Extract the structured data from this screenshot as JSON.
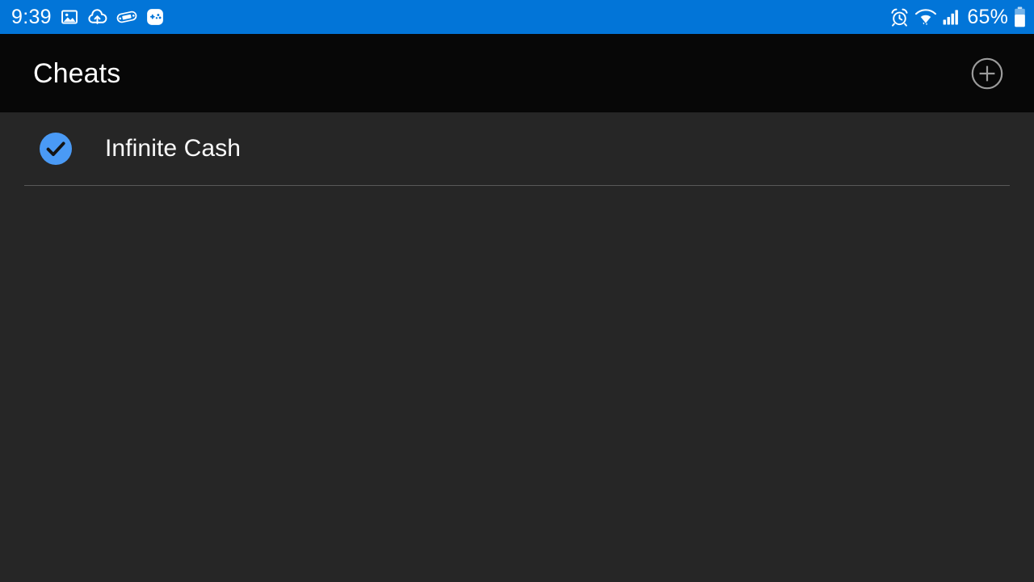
{
  "status_bar": {
    "time": "9:39",
    "battery_percent": "65%",
    "background_color": "#0275d8",
    "foreground_color": "#ffffff",
    "left_icons": [
      {
        "name": "photo-image-icon",
        "label": "Screenshot saved"
      },
      {
        "name": "cloud-upload-icon",
        "label": "Cloud upload"
      },
      {
        "name": "handheld-console-icon",
        "label": "Handheld emulator"
      },
      {
        "name": "gamepad-app-icon",
        "label": "Game controller app"
      }
    ],
    "right_icons": [
      {
        "name": "alarm-clock-icon",
        "label": "Alarm set"
      },
      {
        "name": "wifi-icon",
        "label": "Wi-Fi connected"
      },
      {
        "name": "cellular-signal-icon",
        "label": "Mobile signal"
      },
      {
        "name": "battery-icon",
        "label": "Battery 65 percent"
      }
    ]
  },
  "app_bar": {
    "title": "Cheats",
    "background_color": "#070707",
    "add_button": {
      "name": "add-cheat-button",
      "icon": "plus-circle-icon",
      "label": "Add cheat"
    }
  },
  "content": {
    "background_color": "#262626",
    "accent_color": "#4a9af5",
    "divider_color": "#585858",
    "cheats": [
      {
        "label": "Infinite Cash",
        "enabled": true
      }
    ]
  }
}
